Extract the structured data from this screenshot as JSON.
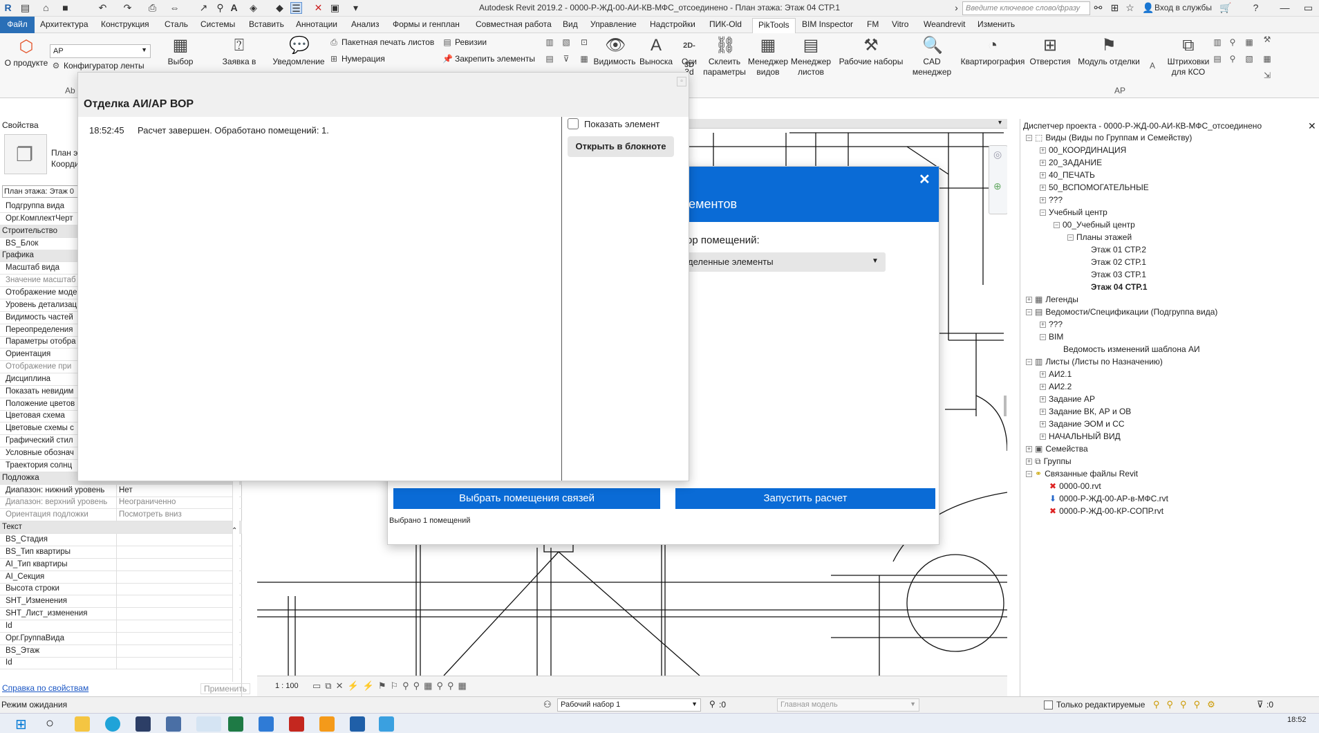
{
  "window_title": "Autodesk Revit 2019.2 - 0000-Р-ЖД-00-АИ-КВ-МФС_отсоединено - План этажа: Этаж 04 СТР.1",
  "search_placeholder": "Введите ключевое слово/фразу",
  "login_label": "Вход в службы",
  "tabs": [
    "Файл",
    "Архитектура",
    "Конструкция",
    "Сталь",
    "Системы",
    "Вставить",
    "Аннотации",
    "Анализ",
    "Формы и генплан",
    "Совместная работа",
    "Вид",
    "Управление",
    "Надстройки",
    "ПИК-Old",
    "PikTools",
    "BIM Inspector",
    "FM",
    "Vitro",
    "Weandrevit",
    "Изменить"
  ],
  "active_tab": "PikTools",
  "ribbon": {
    "about": "О продукте",
    "dropdown_value": "АР",
    "configurator": "Конфигуратор ленты",
    "select": "Выбор",
    "request": "Заявка в",
    "notify": "Уведомление",
    "batch_print": "Пакетная печать листов",
    "numbering": "Нумерация",
    "revisions": "Ревизии",
    "pin": "Закрепить элементы",
    "visibility": "Видимость",
    "callout": "Выноска",
    "axes": "Оси\n3d",
    "axes_icon_text": "2D-3D",
    "link_params": "Склеить\nпараметры",
    "view_manager": "Менеджер\nвидов",
    "sheet_manager": "Менеджер\nлистов",
    "worksets": "Рабочие наборы",
    "cad_manager": "CAD\nменеджер",
    "apartment": "Квартирография",
    "holes": "Отверстия",
    "finish": "Модуль отделки",
    "hatch": "Штриховки\nдля КСО",
    "group_ar": "АР",
    "group_ab": "Аb"
  },
  "properties": {
    "header": "Свойства",
    "type_line1": "План э",
    "type_line2": "Коорди",
    "instance_selector": "План этажа: Этаж 0",
    "rows": [
      {
        "k": "Подгруппа вида",
        "v": "",
        "cls": ""
      },
      {
        "k": "Орг.КомплектЧерт",
        "v": "",
        "cls": ""
      },
      {
        "k": "Строительство",
        "v": "",
        "cls": "cat"
      },
      {
        "k": "BS_Блок",
        "v": "",
        "cls": ""
      },
      {
        "k": "Графика",
        "v": "",
        "cls": "cat"
      },
      {
        "k": "Масштаб вида",
        "v": "",
        "cls": ""
      },
      {
        "k": "Значение масштаб",
        "v": "",
        "cls": "grey"
      },
      {
        "k": "Отображение моде",
        "v": "",
        "cls": ""
      },
      {
        "k": "Уровень детализац",
        "v": "",
        "cls": ""
      },
      {
        "k": "Видимость частей",
        "v": "",
        "cls": ""
      },
      {
        "k": "Переопределения",
        "v": "",
        "cls": ""
      },
      {
        "k": "Параметры отобра",
        "v": "",
        "cls": ""
      },
      {
        "k": "Ориентация",
        "v": "",
        "cls": ""
      },
      {
        "k": "Отображение при",
        "v": "",
        "cls": "grey"
      },
      {
        "k": "Дисциплина",
        "v": "",
        "cls": ""
      },
      {
        "k": "Показать невидим",
        "v": "",
        "cls": ""
      },
      {
        "k": "Положение цветов",
        "v": "",
        "cls": ""
      },
      {
        "k": "Цветовая схема",
        "v": "",
        "cls": ""
      },
      {
        "k": "Цветовые схемы с",
        "v": "",
        "cls": ""
      },
      {
        "k": "Графический стил",
        "v": "",
        "cls": ""
      },
      {
        "k": "Условные обознач",
        "v": "",
        "cls": ""
      },
      {
        "k": "Траектория солнц",
        "v": "",
        "cls": ""
      },
      {
        "k": "Подложка",
        "v": "",
        "cls": "cat"
      },
      {
        "k": "Диапазон: нижний уровень",
        "v": "Нет",
        "cls": ""
      },
      {
        "k": "Диапазон: верхний уровень",
        "v": "Неограниченно",
        "cls": "grey"
      },
      {
        "k": "Ориентация подложки",
        "v": "Посмотреть вниз",
        "cls": "grey"
      },
      {
        "k": "Текст",
        "v": "",
        "cls": "cat"
      },
      {
        "k": "BS_Стадия",
        "v": "",
        "cls": ""
      },
      {
        "k": "BS_Тип квартиры",
        "v": "",
        "cls": ""
      },
      {
        "k": "AI_Тип квартиры",
        "v": "",
        "cls": ""
      },
      {
        "k": "AI_Секция",
        "v": "",
        "cls": ""
      },
      {
        "k": "Высота строки",
        "v": "",
        "cls": ""
      },
      {
        "k": "SHT_Изменения",
        "v": "",
        "cls": ""
      },
      {
        "k": "SHT_Лист_изменения",
        "v": "",
        "cls": ""
      },
      {
        "k": "Id",
        "v": "",
        "cls": ""
      },
      {
        "k": "Орг.ГруппаВида",
        "v": "",
        "cls": ""
      },
      {
        "k": "BS_Этаж",
        "v": "",
        "cls": ""
      },
      {
        "k": "Id",
        "v": "",
        "cls": ""
      }
    ],
    "help_link": "Справка по свойствам",
    "apply": "Применить"
  },
  "scale": "1 : 100",
  "browser": {
    "title": "Диспетчер проекта - 0000-Р-ЖД-00-АИ-КВ-МФС_отсоединено",
    "nodes": [
      {
        "t": "Виды (Виды по Группам и Семейству)",
        "lvl": 0,
        "ex": "−",
        "ic": "views"
      },
      {
        "t": "00_КООРДИНАЦИЯ",
        "lvl": 1,
        "ex": "+"
      },
      {
        "t": "20_ЗАДАНИЕ",
        "lvl": 1,
        "ex": "+"
      },
      {
        "t": "40_ПЕЧАТЬ",
        "lvl": 1,
        "ex": "+"
      },
      {
        "t": "50_ВСПОМОГАТЕЛЬНЫЕ",
        "lvl": 1,
        "ex": "+"
      },
      {
        "t": "???",
        "lvl": 1,
        "ex": "+"
      },
      {
        "t": "Учебный центр",
        "lvl": 1,
        "ex": "−"
      },
      {
        "t": "00_Учебный центр",
        "lvl": 2,
        "ex": "−"
      },
      {
        "t": "Планы этажей",
        "lvl": 3,
        "ex": "−"
      },
      {
        "t": "Этаж 01 СТР.2",
        "lvl": 4,
        "ex": ""
      },
      {
        "t": "Этаж 02 СТР.1",
        "lvl": 4,
        "ex": ""
      },
      {
        "t": "Этаж 03 СТР.1",
        "lvl": 4,
        "ex": ""
      },
      {
        "t": "Этаж 04 СТР.1",
        "lvl": 4,
        "ex": "",
        "sel": true
      },
      {
        "t": "Легенды",
        "lvl": 0,
        "ex": "+",
        "ic": "legend"
      },
      {
        "t": "Ведомости/Спецификации (Подгруппа вида)",
        "lvl": 0,
        "ex": "−",
        "ic": "sched"
      },
      {
        "t": "???",
        "lvl": 1,
        "ex": "+"
      },
      {
        "t": "BIM",
        "lvl": 1,
        "ex": "−"
      },
      {
        "t": "Ведомость изменений шаблона АИ",
        "lvl": 2,
        "ex": ""
      },
      {
        "t": "Листы (Листы по Назначению)",
        "lvl": 0,
        "ex": "−",
        "ic": "sheet"
      },
      {
        "t": "АИ2.1",
        "lvl": 1,
        "ex": "+"
      },
      {
        "t": "АИ2.2",
        "lvl": 1,
        "ex": "+"
      },
      {
        "t": "Задание АР",
        "lvl": 1,
        "ex": "+"
      },
      {
        "t": "Задание ВК, АР и ОВ",
        "lvl": 1,
        "ex": "+"
      },
      {
        "t": "Задание ЭОМ и СС",
        "lvl": 1,
        "ex": "+"
      },
      {
        "t": "НАЧАЛЬНЫЙ ВИД",
        "lvl": 1,
        "ex": "+"
      },
      {
        "t": "Семейства",
        "lvl": 0,
        "ex": "+",
        "ic": "fam"
      },
      {
        "t": "Группы",
        "lvl": 0,
        "ex": "+",
        "ic": "grp"
      },
      {
        "t": "Связанные файлы Revit",
        "lvl": 0,
        "ex": "−",
        "ic": "link"
      },
      {
        "t": "0000-00.rvt",
        "lvl": 1,
        "ex": "",
        "ic": "x"
      },
      {
        "t": "0000-Р-ЖД-00-АР-в-МФС.rvt",
        "lvl": 1,
        "ex": "",
        "ic": "down"
      },
      {
        "t": "0000-Р-ЖД-00-КР-СОПР.rvt",
        "lvl": 1,
        "ex": "",
        "ic": "x"
      }
    ]
  },
  "dialog1": {
    "title": "Отделка АИ/АР ВОР",
    "log_time": "18:52:45",
    "log_text": "Расчет завершен. Обработано помещений: 1.",
    "show_element": "Показать элемент",
    "open_notepad": "Открыть в блокноте"
  },
  "dialog2": {
    "title": "Наименование элементов",
    "label": "ор помещений:",
    "select_value": "деленные элементы",
    "btn_select": "Выбрать помещения связей",
    "btn_run": "Запустить расчет",
    "status": "Выбрано 1 помещений"
  },
  "statusbar": {
    "state": "Режим ожидания",
    "workset": "Рабочий набор 1",
    "zero": ":0",
    "model": "Главная модель",
    "only_editable": "Только редактируемые",
    "filter": ":0"
  },
  "clock": {
    "time": "18:52"
  },
  "colors": {
    "accent": "#0a6bd6",
    "file_tab": "#2a6fb7"
  }
}
